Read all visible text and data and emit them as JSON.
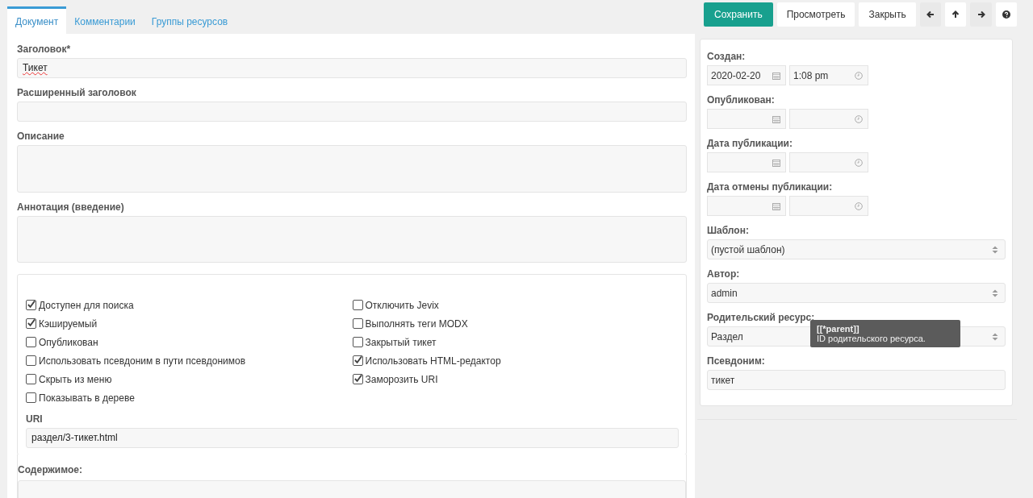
{
  "tabs": [
    {
      "label": "Документ",
      "selected": true
    },
    {
      "label": "Комментарии",
      "selected": false
    },
    {
      "label": "Группы ресурсов",
      "selected": false
    }
  ],
  "toolbar": {
    "buttons": [
      {
        "label": "Сохранить",
        "kind": "primary"
      },
      {
        "label": "Просмотреть",
        "kind": "plain"
      },
      {
        "label": "Закрыть",
        "kind": "plain"
      }
    ],
    "icon_buttons": [
      {
        "kind": "left",
        "disabled": true
      },
      {
        "kind": "up",
        "disabled": false
      },
      {
        "kind": "right",
        "disabled": true
      },
      {
        "kind": "help",
        "disabled": false
      }
    ]
  },
  "fields": [
    {
      "label": "Заголовок*",
      "value": "Тикет",
      "kind": "input"
    },
    {
      "label": "Расширенный заголовок",
      "kind": "input"
    },
    {
      "label": "Описание",
      "kind": "textarea"
    },
    {
      "label": "Аннотация (введение)",
      "kind": "textarea"
    }
  ],
  "options": {
    "left": [
      {
        "label": "Доступен для поиска",
        "checked": true
      },
      {
        "label": "Кэшируемый",
        "checked": true
      },
      {
        "label": "Опубликован",
        "checked": false
      },
      {
        "label": "Использовать псевдоним в пути псевдонимов",
        "checked": false
      },
      {
        "label": "Скрыть из меню",
        "checked": false
      },
      {
        "label": "Показывать в дереве",
        "checked": false
      }
    ],
    "right": [
      {
        "label": "Отключить Jevix",
        "checked": false
      },
      {
        "label": "Выполнять теги MODX",
        "checked": false
      },
      {
        "label": "Закрытый тикет",
        "checked": false
      },
      {
        "label": "Использовать HTML-редактор",
        "checked": true
      },
      {
        "label": "Заморозить URI",
        "checked": true
      }
    ],
    "uri": {
      "label": "URI",
      "value": "раздел/3-тикет.html"
    }
  },
  "content": {
    "label": "Содержимое:"
  },
  "dates": [
    {
      "label": "Создан:",
      "date": "2020-02-20",
      "time": "1:08 pm"
    },
    {
      "label": "Опубликован:"
    },
    {
      "label": "Дата публикации:"
    },
    {
      "label": "Дата отмены публикации:"
    }
  ],
  "settings": [
    {
      "label": "Шаблон:",
      "value": "(пустой шаблон)",
      "kind": "select"
    },
    {
      "label": "Автор:",
      "value": "admin",
      "kind": "select"
    },
    {
      "label": "Родительский ресурс:",
      "value": "Раздел",
      "kind": "select",
      "tooltip": {
        "title": "[[*parent]]",
        "text": "ID родительского ресурса."
      }
    },
    {
      "label": "Псевдоним:",
      "value": "тикет",
      "kind": "input"
    }
  ]
}
